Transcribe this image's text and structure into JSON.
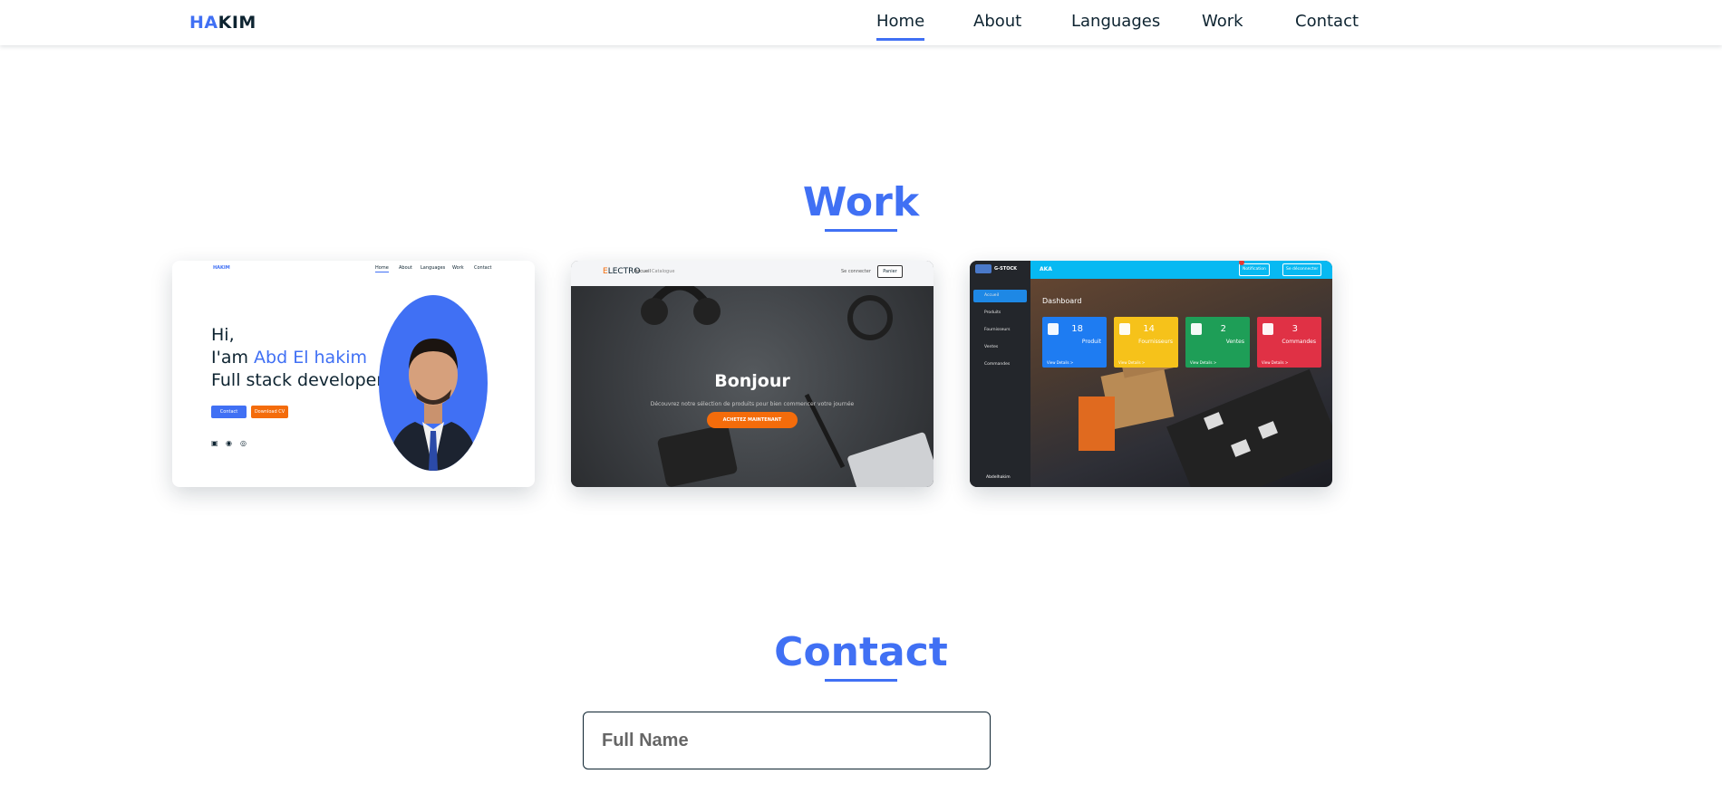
{
  "logo": {
    "highlight": "HA",
    "rest": "KIM"
  },
  "nav": [
    {
      "label": "Home",
      "active": true
    },
    {
      "label": "About",
      "active": false
    },
    {
      "label": "Languages",
      "active": false
    },
    {
      "label": "Work",
      "active": false
    },
    {
      "label": "Contact",
      "active": false
    }
  ],
  "work": {
    "title": "Work",
    "projects": [
      {
        "kind": "portfolio",
        "logo": "HAKIM",
        "nav": [
          "Home",
          "About",
          "Languages",
          "Work",
          "Contact"
        ],
        "greeting": "Hi,",
        "intro_prefix": "I'am ",
        "name": "Abd El hakim",
        "role": "Full stack developer",
        "buttons": [
          "Contact",
          "Download CV"
        ]
      },
      {
        "kind": "shop",
        "logo_first": "E",
        "logo_rest": "LECTRO",
        "nav": [
          "Accueil",
          "Catalogue"
        ],
        "login": "Se connecter",
        "cart": "Panier",
        "heading": "Bonjour",
        "subtitle": "Découvrez notre sélection de produits pour bien commencer votre journée",
        "cta": "ACHETEZ MAINTENANT"
      },
      {
        "kind": "dashboard",
        "brand": "G-STOCK",
        "topbar_logo": "AKA",
        "notification": "Notification",
        "logout": "Se déconnecter",
        "sidebar": [
          "Accueil",
          "Produits",
          "Fournisseurs",
          "Ventes",
          "Commandes"
        ],
        "user": "Abdelhakim",
        "heading": "Dashboard",
        "tiles": [
          {
            "value": "18",
            "label": "Produit",
            "more": "View Details >",
            "color": "#1e7cf2"
          },
          {
            "value": "14",
            "label": "Fournisseurs",
            "more": "View Details >",
            "color": "#f6c21a"
          },
          {
            "value": "2",
            "label": "Ventes",
            "more": "View Details >",
            "color": "#1e9e57"
          },
          {
            "value": "3",
            "label": "Commandes",
            "more": "View Details >",
            "color": "#e03145"
          }
        ]
      }
    ]
  },
  "contact": {
    "title": "Contact",
    "full_name_placeholder": "Full Name"
  },
  "colors": {
    "accent": "#4070f4",
    "text": "#0e2431",
    "orange": "#f46c0b"
  }
}
